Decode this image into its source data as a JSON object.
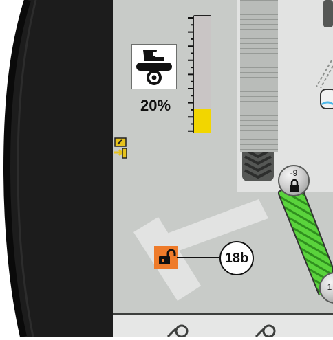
{
  "tractor_panel": {
    "icon": "tractor-rear-icon",
    "percent_text": "20%",
    "level_fraction": 0.2
  },
  "callout": {
    "label": "18b"
  },
  "knob_top": {
    "value": "-9",
    "icon": "lock-icon"
  },
  "knob_bottom": {
    "value": "1"
  },
  "lock_button": {
    "icon": "unlock-icon",
    "color": "#ee7b2a"
  },
  "bar": {
    "fill_color": "#f2d600"
  },
  "conveyor": {
    "color": "#5ad33c"
  }
}
